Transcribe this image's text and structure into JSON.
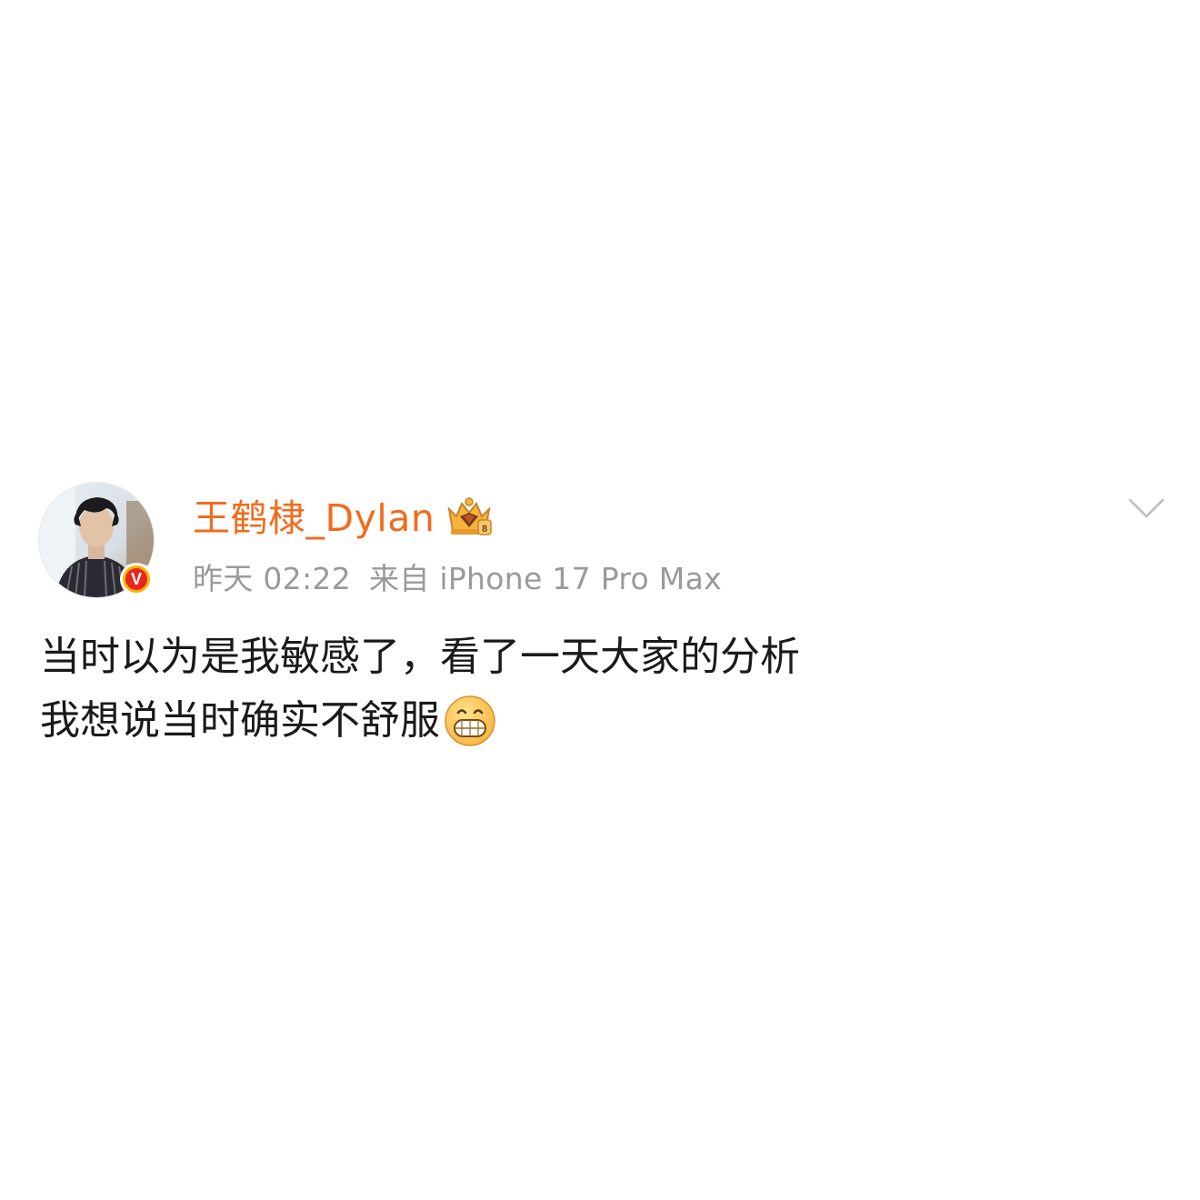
{
  "post": {
    "author": {
      "name": "王鹤棣_Dylan",
      "avatar_icon": "user-avatar",
      "verified_badge_icon": "verified-v-icon",
      "verified_badge_letter": "V",
      "member_badge_icon": "crown-badge-icon",
      "name_color": "#f26b1d"
    },
    "timestamp": "昨天 02:22",
    "source": "来自 iPhone 17 Pro Max",
    "menu_icon": "chevron-down-icon",
    "content": {
      "line1": "当时以为是我敏感了，看了一天大家的分析",
      "line2": "我想说当时确实不舒服",
      "emoji_icon": "grinning-emoji-icon"
    }
  }
}
